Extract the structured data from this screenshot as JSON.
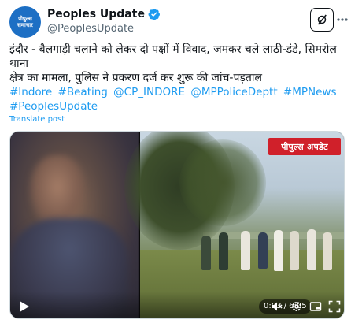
{
  "account": {
    "display_name": "Peoples Update",
    "handle": "@PeoplesUpdate",
    "avatar_text": "पीपुल्स समाचार"
  },
  "tweet": {
    "line1": "इंदौर - बैलगाड़ी चलाने को लेकर दो पक्षों में विवाद, जमकर चले लाठी-डंडे, सिमरोल थाना",
    "line2": "क्षेत्र का मामला, पुलिस ने प्रकरण दर्ज कर शुरू की जांच-पड़ताल",
    "hashtags": [
      "#Indore",
      "#Beating",
      "@CP_INDORE",
      "@MPPoliceDeptt",
      "#MPNews",
      "#PeoplesUpdate"
    ],
    "translate_label": "Translate post"
  },
  "video": {
    "badge_text": "पीपुल्स अपडेट",
    "time": "0:03 / 6:05",
    "play_icon": "play-icon",
    "colors": {
      "badge": "#d0202a",
      "link": "#1d9bf0"
    }
  }
}
